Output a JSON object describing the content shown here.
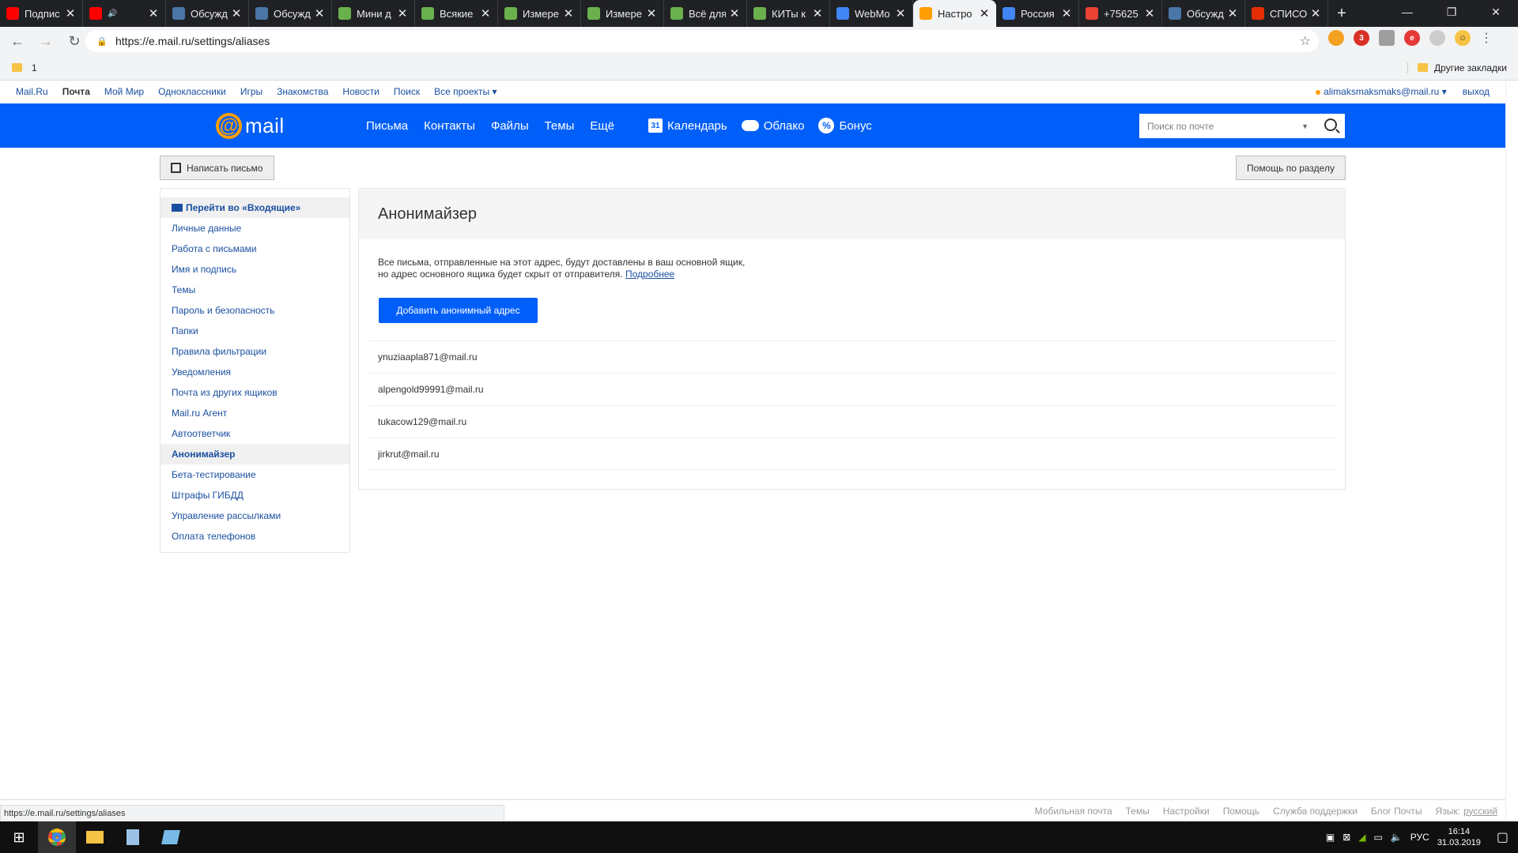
{
  "tabs": [
    {
      "title": "Подпис",
      "fav": "youtube-icon",
      "color": "#ff0000",
      "audio": false
    },
    {
      "title": "",
      "fav": "youtube-icon",
      "color": "#ff0000",
      "audio": true
    },
    {
      "title": "Обсужд",
      "fav": "vk-icon",
      "color": "#4a76a8"
    },
    {
      "title": "Обсужд",
      "fav": "vk-icon",
      "color": "#4a76a8"
    },
    {
      "title": "Мини д",
      "fav": "green-icon",
      "color": "#6ab04c"
    },
    {
      "title": "Всякие",
      "fav": "green-icon",
      "color": "#6ab04c"
    },
    {
      "title": "Измере",
      "fav": "green-icon",
      "color": "#6ab04c"
    },
    {
      "title": "Измере",
      "fav": "green-icon",
      "color": "#6ab04c"
    },
    {
      "title": "Всё для",
      "fav": "green-icon",
      "color": "#6ab04c"
    },
    {
      "title": "КИТы к",
      "fav": "green-icon",
      "color": "#6ab04c"
    },
    {
      "title": "WebMo",
      "fav": "globe-icon",
      "color": "#4285f4"
    },
    {
      "title": "Настро",
      "fav": "mail-at-icon",
      "color": "#ff9e00",
      "active": true
    },
    {
      "title": "Россия",
      "fav": "globe-icon",
      "color": "#4285f4"
    },
    {
      "title": "+75625",
      "fav": "google-icon",
      "color": "#ea4335"
    },
    {
      "title": "Обсужд",
      "fav": "vk-icon",
      "color": "#4a76a8"
    },
    {
      "title": "СПИСО",
      "fav": "aliexpress-icon",
      "color": "#e62e04"
    }
  ],
  "browser": {
    "url": "https://e.mail.ru/settings/aliases",
    "bookmark_1": "1",
    "other_bookmarks": "Другие закладки"
  },
  "portal": {
    "links": [
      "Mail.Ru",
      "Почта",
      "Мой Мир",
      "Одноклассники",
      "Игры",
      "Знакомства",
      "Новости",
      "Поиск",
      "Все проекты ▾"
    ],
    "user": "alimaksmaksmaks@mail.ru ▾",
    "logout": "выход"
  },
  "header": {
    "logo_text": "mail",
    "nav": [
      "Письма",
      "Контакты",
      "Файлы",
      "Темы",
      "Ещё"
    ],
    "calendar": "Календарь",
    "calendar_day": "31",
    "cloud": "Облако",
    "bonus": "Бонус",
    "search_placeholder": "Поиск по почте"
  },
  "toolbar": {
    "compose": "Написать письмо",
    "help": "Помощь по разделу"
  },
  "sidebar": {
    "inbox": "Перейти во «Входящие»",
    "items": [
      "Личные данные",
      "Работа с письмами",
      "Имя и подпись",
      "Темы",
      "Пароль и безопасность",
      "Папки",
      "Правила фильтрации",
      "Уведомления",
      "Почта из других ящиков",
      "Mail.ru Агент",
      "Автоответчик",
      "Анонимайзер",
      "Бета-тестирование",
      "Штрафы ГИБДД",
      "Управление рассылками",
      "Оплата телефонов"
    ],
    "active_index": 11
  },
  "content": {
    "title": "Анонимайзер",
    "desc_line1": "Все письма, отправленные на этот адрес, будут доставлены в ваш основной ящик,",
    "desc_line2": "но адрес основного ящика будет скрыт от отправителя.",
    "more_link": "Подробнее",
    "add_button": "Добавить анонимный адрес",
    "aliases": [
      "ynuziaapla871@mail.ru",
      "alpengold99991@mail.ru",
      "tukacow129@mail.ru",
      "jirkrut@mail.ru"
    ]
  },
  "footer": {
    "status_url": "https://e.mail.ru/settings/aliases",
    "links": [
      "Мобильная почта",
      "Темы",
      "Настройки",
      "Помощь",
      "Служба поддержки",
      "Блог Почты"
    ],
    "lang_label": "Язык:",
    "lang_value": "русский"
  },
  "taskbar": {
    "lang": "РУС",
    "time": "16:14",
    "date": "31.03.2019"
  },
  "colors": {
    "brand_blue": "#005ff9",
    "accent_orange": "#ff9e00",
    "link": "#1a4fa0"
  }
}
